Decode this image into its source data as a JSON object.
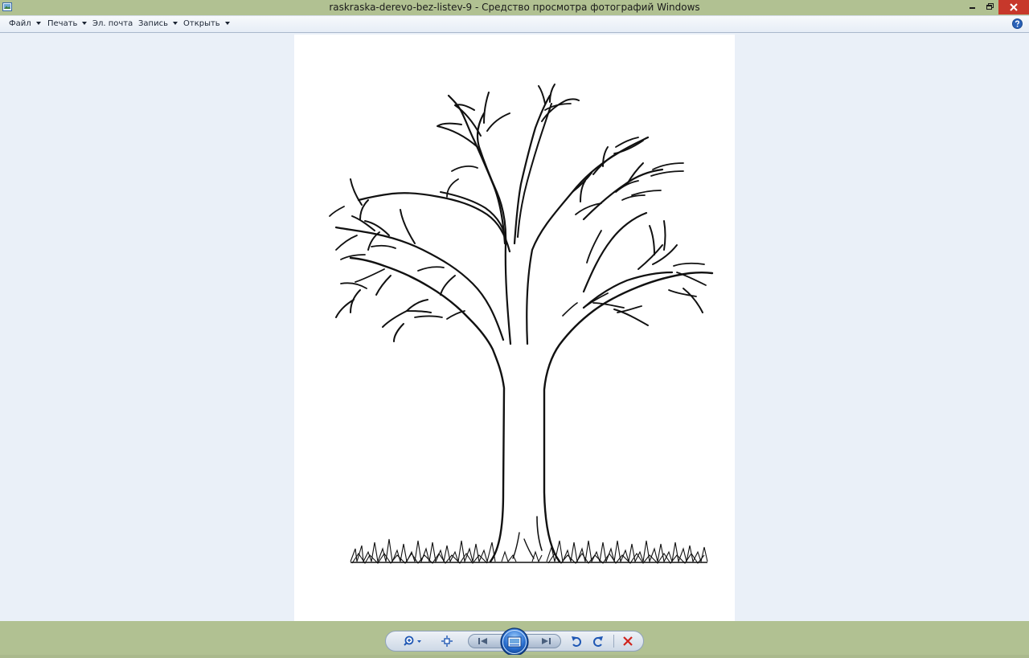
{
  "window": {
    "title": "raskraska-derevo-bez-listev-9 - Средство просмотра фотографий Windows",
    "app_icon": "photo-viewer-icon",
    "controls": {
      "minimize_icon": "minimize-icon",
      "restore_icon": "restore-icon",
      "close_icon": "close-icon"
    }
  },
  "menu": {
    "items": [
      {
        "label": "Файл",
        "has_dropdown": true
      },
      {
        "label": "Печать",
        "has_dropdown": true
      },
      {
        "label": "Эл. почта",
        "has_dropdown": false
      },
      {
        "label": "Запись",
        "has_dropdown": true
      },
      {
        "label": "Открыть",
        "has_dropdown": true
      }
    ],
    "help_icon": "help-icon"
  },
  "image": {
    "description_icon": "bare-tree-coloring-page"
  },
  "toolbar": {
    "buttons": [
      {
        "name": "zoom",
        "icon": "zoom-icon",
        "has_dropdown": true
      },
      {
        "name": "actual-size",
        "icon": "fit-window-icon"
      },
      {
        "name": "previous",
        "icon": "previous-icon"
      },
      {
        "name": "slideshow",
        "icon": "slideshow-icon"
      },
      {
        "name": "next",
        "icon": "next-icon"
      },
      {
        "name": "rotate-left",
        "icon": "rotate-counterclockwise-icon"
      },
      {
        "name": "rotate-right",
        "icon": "rotate-clockwise-icon"
      },
      {
        "name": "delete",
        "icon": "delete-icon"
      }
    ]
  },
  "colors": {
    "titlebar": "#b1c192",
    "close_button": "#c7382b",
    "background": "#eaf0f8",
    "delete_icon": "#d0231c",
    "rotate_icon": "#1f57b4"
  }
}
